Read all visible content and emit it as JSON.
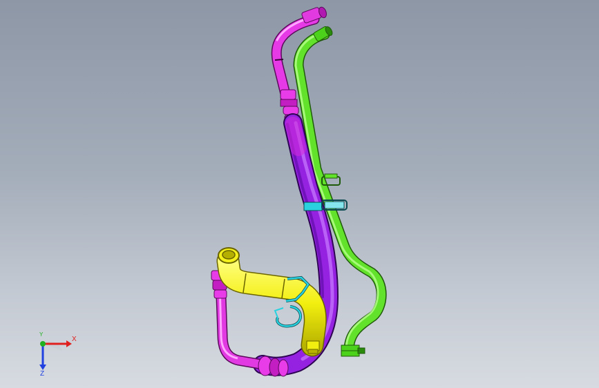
{
  "viewport": {
    "background_top": "#8d97a6",
    "background_bottom": "#d7dbe1"
  },
  "model": {
    "parts": [
      {
        "name": "magenta-pipe",
        "color": "#e11ee1"
      },
      {
        "name": "purple-pipe",
        "color": "#9b22e8"
      },
      {
        "name": "green-pipe",
        "color": "#55e61e"
      },
      {
        "name": "yellow-pipe",
        "color": "#f2f01a"
      },
      {
        "name": "cyan-clamp",
        "color": "#2ad2e0"
      }
    ]
  },
  "triad": {
    "x_label": "X",
    "y_label": "Y",
    "z_label": "Z",
    "x_color": "#e0201e",
    "y_color": "#20b020",
    "z_color": "#2040e0"
  }
}
